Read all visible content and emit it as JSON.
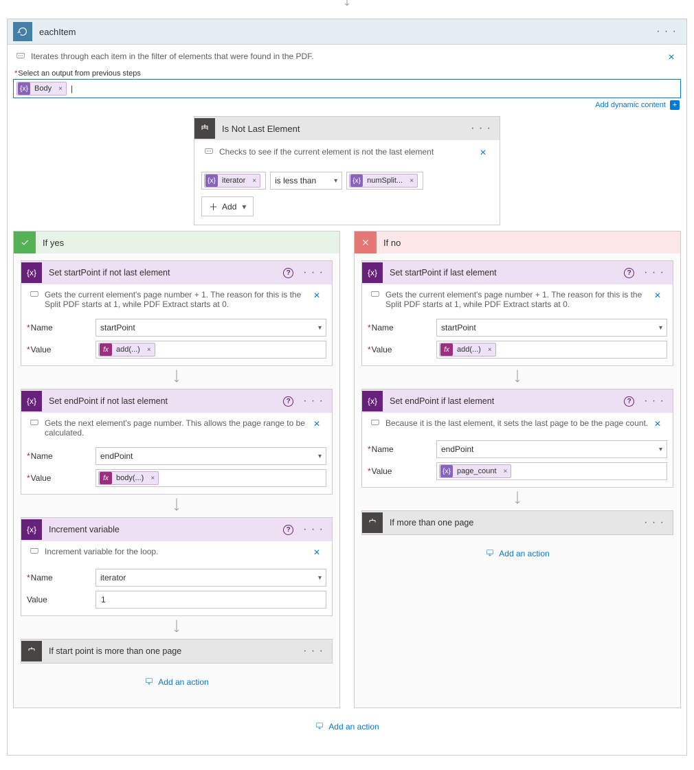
{
  "topLoop": {
    "title": "eachItem",
    "comment": "Iterates through each item in the filter of elements that were found in the PDF.",
    "selectLabel": "Select an output from previous steps",
    "bodyPill": "Body",
    "dynamicContent": "Add dynamic content"
  },
  "condition": {
    "title": "Is Not Last Element",
    "comment": "Checks to see if the current element is not the last element",
    "left": "iterator",
    "operator": "is less than",
    "right": "numSplit...",
    "addBtn": "Add"
  },
  "yes": {
    "label": "If yes",
    "a1": {
      "title": "Set startPoint if not last element",
      "comment": "Gets the current element's page number + 1. The reason for this is the Split PDF starts at 1, while PDF Extract starts at 0.",
      "nameLabel": "Name",
      "nameValue": "startPoint",
      "valueLabel": "Value",
      "valuePill": "add(...)"
    },
    "a2": {
      "title": "Set endPoint if not last element",
      "comment": "Gets the next element's page number. This allows the page range to be calculated.",
      "nameLabel": "Name",
      "nameValue": "endPoint",
      "valueLabel": "Value",
      "valuePill": "body(...)"
    },
    "a3": {
      "title": "Increment variable",
      "comment": "Increment variable for the loop.",
      "nameLabel": "Name",
      "nameValue": "iterator",
      "valueLabel": "Value",
      "valueValue": "1"
    },
    "a4": {
      "title": "If start point is more than one page"
    },
    "addAction": "Add an action"
  },
  "no": {
    "label": "If no",
    "a1": {
      "title": "Set startPoint if last element",
      "comment": "Gets the current element's page number + 1. The reason for this is the Split PDF starts at 1, while PDF Extract starts at 0.",
      "nameLabel": "Name",
      "nameValue": "startPoint",
      "valueLabel": "Value",
      "valuePill": "add(...)"
    },
    "a2": {
      "title": "Set endPoint if last element",
      "comment": "Because it is the last element, it sets the last page to be the page count.",
      "nameLabel": "Name",
      "nameValue": "endPoint",
      "valueLabel": "Value",
      "valuePill": "page_count"
    },
    "a3": {
      "title": "If more than one page"
    },
    "addAction": "Add an action"
  },
  "bottomAddAction": "Add an action"
}
